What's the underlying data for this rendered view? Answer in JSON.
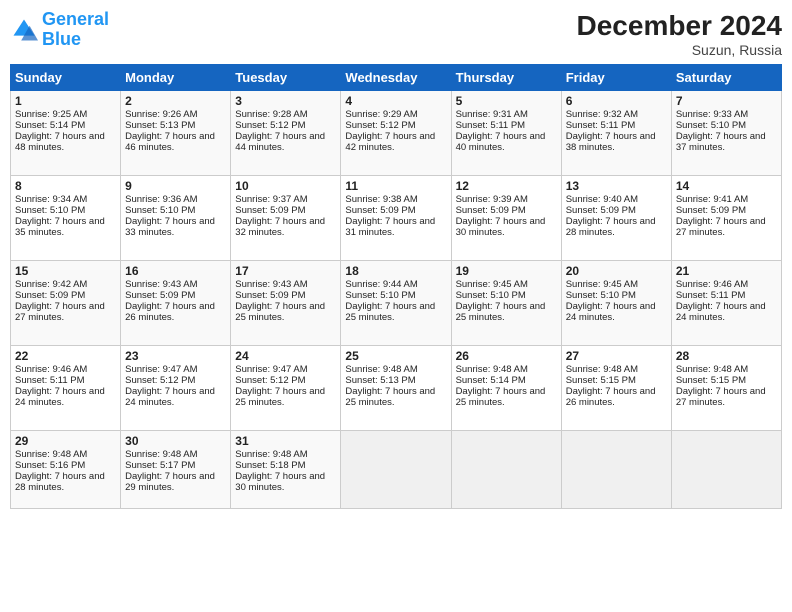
{
  "logo": {
    "line1": "General",
    "line2": "Blue"
  },
  "title": "December 2024",
  "location": "Suzun, Russia",
  "headers": [
    "Sunday",
    "Monday",
    "Tuesday",
    "Wednesday",
    "Thursday",
    "Friday",
    "Saturday"
  ],
  "weeks": [
    [
      {
        "day": "1",
        "sunrise": "Sunrise: 9:25 AM",
        "sunset": "Sunset: 5:14 PM",
        "daylight": "Daylight: 7 hours and 48 minutes."
      },
      {
        "day": "2",
        "sunrise": "Sunrise: 9:26 AM",
        "sunset": "Sunset: 5:13 PM",
        "daylight": "Daylight: 7 hours and 46 minutes."
      },
      {
        "day": "3",
        "sunrise": "Sunrise: 9:28 AM",
        "sunset": "Sunset: 5:12 PM",
        "daylight": "Daylight: 7 hours and 44 minutes."
      },
      {
        "day": "4",
        "sunrise": "Sunrise: 9:29 AM",
        "sunset": "Sunset: 5:12 PM",
        "daylight": "Daylight: 7 hours and 42 minutes."
      },
      {
        "day": "5",
        "sunrise": "Sunrise: 9:31 AM",
        "sunset": "Sunset: 5:11 PM",
        "daylight": "Daylight: 7 hours and 40 minutes."
      },
      {
        "day": "6",
        "sunrise": "Sunrise: 9:32 AM",
        "sunset": "Sunset: 5:11 PM",
        "daylight": "Daylight: 7 hours and 38 minutes."
      },
      {
        "day": "7",
        "sunrise": "Sunrise: 9:33 AM",
        "sunset": "Sunset: 5:10 PM",
        "daylight": "Daylight: 7 hours and 37 minutes."
      }
    ],
    [
      {
        "day": "8",
        "sunrise": "Sunrise: 9:34 AM",
        "sunset": "Sunset: 5:10 PM",
        "daylight": "Daylight: 7 hours and 35 minutes."
      },
      {
        "day": "9",
        "sunrise": "Sunrise: 9:36 AM",
        "sunset": "Sunset: 5:10 PM",
        "daylight": "Daylight: 7 hours and 33 minutes."
      },
      {
        "day": "10",
        "sunrise": "Sunrise: 9:37 AM",
        "sunset": "Sunset: 5:09 PM",
        "daylight": "Daylight: 7 hours and 32 minutes."
      },
      {
        "day": "11",
        "sunrise": "Sunrise: 9:38 AM",
        "sunset": "Sunset: 5:09 PM",
        "daylight": "Daylight: 7 hours and 31 minutes."
      },
      {
        "day": "12",
        "sunrise": "Sunrise: 9:39 AM",
        "sunset": "Sunset: 5:09 PM",
        "daylight": "Daylight: 7 hours and 30 minutes."
      },
      {
        "day": "13",
        "sunrise": "Sunrise: 9:40 AM",
        "sunset": "Sunset: 5:09 PM",
        "daylight": "Daylight: 7 hours and 28 minutes."
      },
      {
        "day": "14",
        "sunrise": "Sunrise: 9:41 AM",
        "sunset": "Sunset: 5:09 PM",
        "daylight": "Daylight: 7 hours and 27 minutes."
      }
    ],
    [
      {
        "day": "15",
        "sunrise": "Sunrise: 9:42 AM",
        "sunset": "Sunset: 5:09 PM",
        "daylight": "Daylight: 7 hours and 27 minutes."
      },
      {
        "day": "16",
        "sunrise": "Sunrise: 9:43 AM",
        "sunset": "Sunset: 5:09 PM",
        "daylight": "Daylight: 7 hours and 26 minutes."
      },
      {
        "day": "17",
        "sunrise": "Sunrise: 9:43 AM",
        "sunset": "Sunset: 5:09 PM",
        "daylight": "Daylight: 7 hours and 25 minutes."
      },
      {
        "day": "18",
        "sunrise": "Sunrise: 9:44 AM",
        "sunset": "Sunset: 5:10 PM",
        "daylight": "Daylight: 7 hours and 25 minutes."
      },
      {
        "day": "19",
        "sunrise": "Sunrise: 9:45 AM",
        "sunset": "Sunset: 5:10 PM",
        "daylight": "Daylight: 7 hours and 25 minutes."
      },
      {
        "day": "20",
        "sunrise": "Sunrise: 9:45 AM",
        "sunset": "Sunset: 5:10 PM",
        "daylight": "Daylight: 7 hours and 24 minutes."
      },
      {
        "day": "21",
        "sunrise": "Sunrise: 9:46 AM",
        "sunset": "Sunset: 5:11 PM",
        "daylight": "Daylight: 7 hours and 24 minutes."
      }
    ],
    [
      {
        "day": "22",
        "sunrise": "Sunrise: 9:46 AM",
        "sunset": "Sunset: 5:11 PM",
        "daylight": "Daylight: 7 hours and 24 minutes."
      },
      {
        "day": "23",
        "sunrise": "Sunrise: 9:47 AM",
        "sunset": "Sunset: 5:12 PM",
        "daylight": "Daylight: 7 hours and 24 minutes."
      },
      {
        "day": "24",
        "sunrise": "Sunrise: 9:47 AM",
        "sunset": "Sunset: 5:12 PM",
        "daylight": "Daylight: 7 hours and 25 minutes."
      },
      {
        "day": "25",
        "sunrise": "Sunrise: 9:48 AM",
        "sunset": "Sunset: 5:13 PM",
        "daylight": "Daylight: 7 hours and 25 minutes."
      },
      {
        "day": "26",
        "sunrise": "Sunrise: 9:48 AM",
        "sunset": "Sunset: 5:14 PM",
        "daylight": "Daylight: 7 hours and 25 minutes."
      },
      {
        "day": "27",
        "sunrise": "Sunrise: 9:48 AM",
        "sunset": "Sunset: 5:15 PM",
        "daylight": "Daylight: 7 hours and 26 minutes."
      },
      {
        "day": "28",
        "sunrise": "Sunrise: 9:48 AM",
        "sunset": "Sunset: 5:15 PM",
        "daylight": "Daylight: 7 hours and 27 minutes."
      }
    ],
    [
      {
        "day": "29",
        "sunrise": "Sunrise: 9:48 AM",
        "sunset": "Sunset: 5:16 PM",
        "daylight": "Daylight: 7 hours and 28 minutes."
      },
      {
        "day": "30",
        "sunrise": "Sunrise: 9:48 AM",
        "sunset": "Sunset: 5:17 PM",
        "daylight": "Daylight: 7 hours and 29 minutes."
      },
      {
        "day": "31",
        "sunrise": "Sunrise: 9:48 AM",
        "sunset": "Sunset: 5:18 PM",
        "daylight": "Daylight: 7 hours and 30 minutes."
      },
      null,
      null,
      null,
      null
    ]
  ]
}
